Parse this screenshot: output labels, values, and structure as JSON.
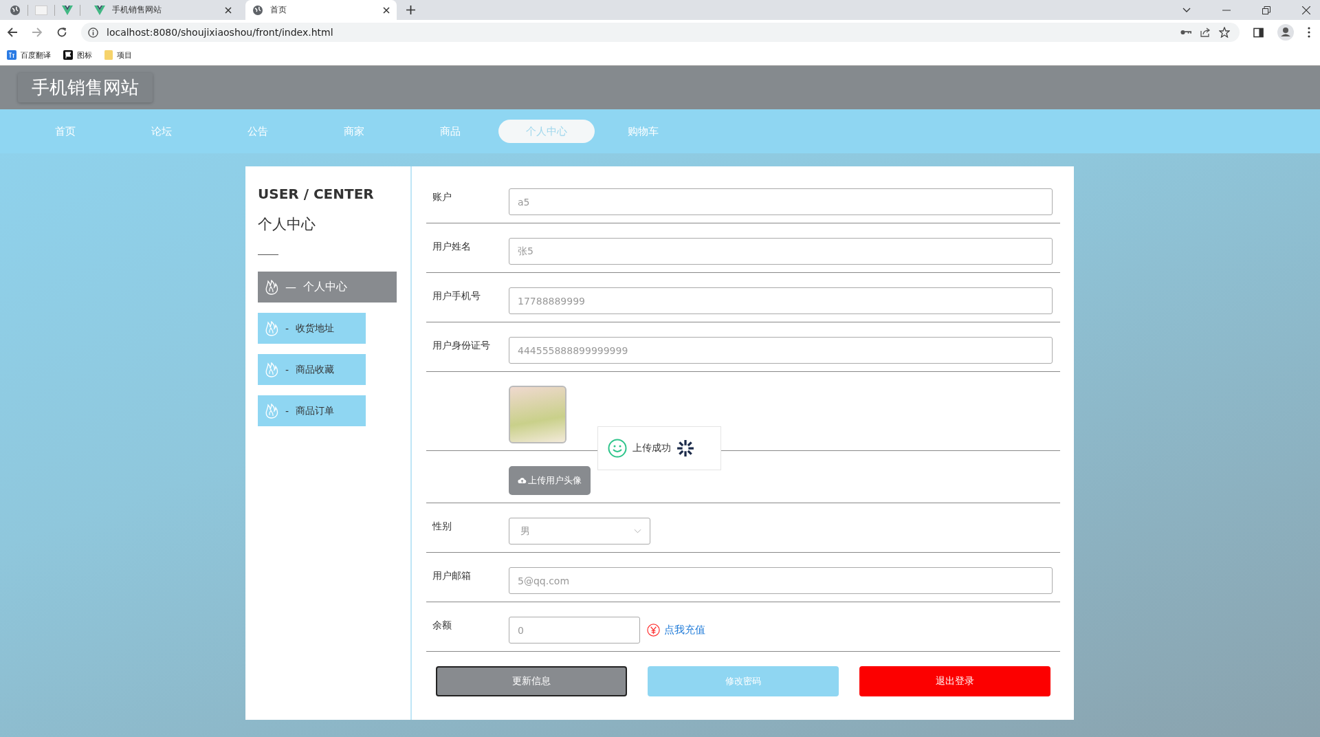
{
  "browser": {
    "tabs": [
      {
        "title": "手机销售网站",
        "selected": false
      },
      {
        "title": "首页",
        "selected": true
      }
    ],
    "address": "localhost:8080/shoujixiaoshou/front/index.html",
    "bookmarks": [
      {
        "label": "百度翻译",
        "kind": "translate"
      },
      {
        "label": "图标",
        "kind": "flag"
      },
      {
        "label": "项目",
        "kind": "folder"
      }
    ]
  },
  "site": {
    "title": "手机销售网站",
    "nav": [
      {
        "label": "首页",
        "selected": false
      },
      {
        "label": "论坛",
        "selected": false
      },
      {
        "label": "公告",
        "selected": false
      },
      {
        "label": "商家",
        "selected": false
      },
      {
        "label": "商品",
        "selected": false
      },
      {
        "label": "个人中心",
        "selected": true
      },
      {
        "label": "购物车",
        "selected": false
      }
    ]
  },
  "sidebar": {
    "heading": "USER / CENTER",
    "subtitle": "个人中心",
    "items": [
      {
        "prefix": "—",
        "label": "个人中心",
        "selected": true
      },
      {
        "prefix": "-",
        "label": "收货地址",
        "selected": false
      },
      {
        "prefix": "-",
        "label": "商品收藏",
        "selected": false
      },
      {
        "prefix": "-",
        "label": "商品订单",
        "selected": false
      }
    ]
  },
  "form": {
    "rows": [
      {
        "kind": "text",
        "label": "账户",
        "value": "a5"
      },
      {
        "kind": "text",
        "label": "用户姓名",
        "value": "张5"
      },
      {
        "kind": "text",
        "label": "用户手机号",
        "value": "17788889999"
      },
      {
        "kind": "text",
        "label": "用户身份证号",
        "value": "444555888899999999"
      },
      {
        "kind": "avatar"
      },
      {
        "kind": "upload",
        "button": "上传用户头像"
      },
      {
        "kind": "select",
        "label": "性别",
        "value": "男"
      },
      {
        "kind": "text",
        "label": "用户邮箱",
        "value": "5@qq.com"
      },
      {
        "kind": "balance",
        "label": "余额",
        "value": "0",
        "link": "点我充值"
      }
    ],
    "actions": [
      {
        "kind": "update",
        "label": "更新信息"
      },
      {
        "kind": "password",
        "label": "修改密码"
      },
      {
        "kind": "logout",
        "label": "退出登录"
      }
    ]
  },
  "toast": {
    "message": "上传成功"
  }
}
